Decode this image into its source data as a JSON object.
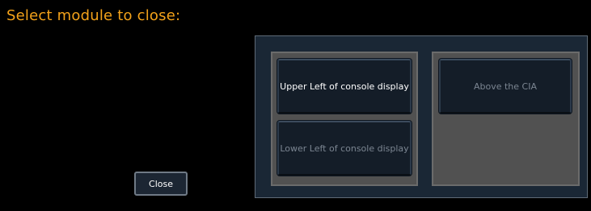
{
  "dialog": {
    "title": "Select module to close:",
    "close_label": "Close"
  },
  "modules": {
    "upper_left": {
      "label": "Upper Left of console display",
      "state": "active"
    },
    "lower_left": {
      "label": "Lower Left of console display",
      "state": "inactive"
    },
    "above_cia": {
      "label": "Above the CIA",
      "state": "inactive"
    }
  },
  "colors": {
    "title": "#f3a21a",
    "background": "#000000",
    "panel": "#1a2735",
    "column": "#515151"
  }
}
